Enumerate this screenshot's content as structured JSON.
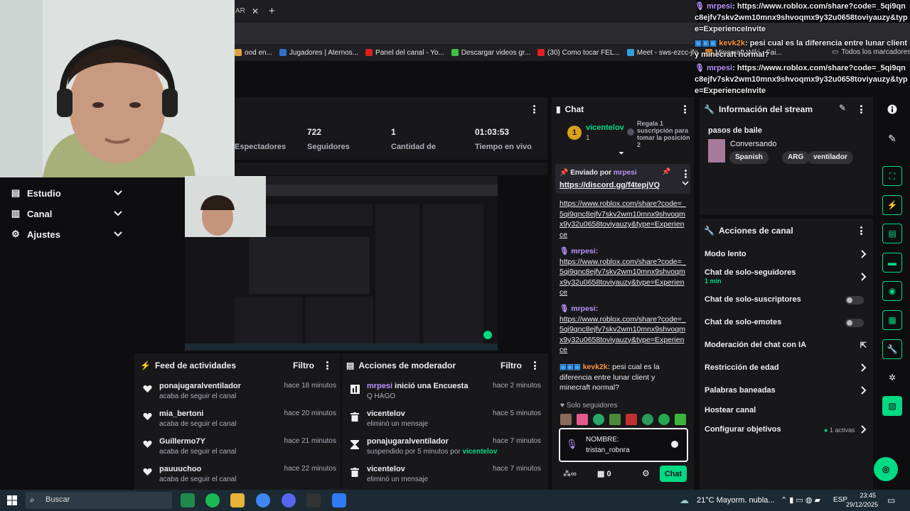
{
  "browser": {
    "tab_fragment": "AR",
    "bookmarks": [
      {
        "label": "ood en...",
        "color": "#e0a040"
      },
      {
        "label": "Jugadores | Aternos...",
        "color": "#3070d0"
      },
      {
        "label": "Panel del canal - Yo...",
        "color": "#e02020"
      },
      {
        "label": "Descargar videos gr...",
        "color": "#40c040"
      },
      {
        "label": "(30) Como tocar FEL...",
        "color": "#e02020"
      },
      {
        "label": "Meet - sws-ezcc-jfq",
        "color": "#30a0e0"
      },
      {
        "label": "Minecraft Wiki - Fai...",
        "color": "#e08020"
      }
    ],
    "all_bookmarks": "Todos los marcadores"
  },
  "nav": {
    "items": [
      {
        "label": "Estudio"
      },
      {
        "label": "Canal"
      },
      {
        "label": "Ajustes"
      }
    ]
  },
  "stats": {
    "items": [
      {
        "value": "",
        "label": "Espectadores"
      },
      {
        "value": "722",
        "label": "Seguidores"
      },
      {
        "value": "1",
        "label": "Cantidad de"
      },
      {
        "value": "01:03:53",
        "label": "Tiempo en vivo"
      }
    ]
  },
  "activity": {
    "title": "Feed de actividades",
    "filter": "Filtro",
    "rows": [
      {
        "name": "ponajugaralventilador",
        "sub": "acaba de seguir el canal",
        "time": "hace 18 minutos"
      },
      {
        "name": "mia_bertoni",
        "sub": "acaba de seguir el canal",
        "time": "hace 20 minutos"
      },
      {
        "name": "Guillermo7Y",
        "sub": "acaba de seguir el canal",
        "time": "hace 21 minutos"
      },
      {
        "name": "pauuuchoo",
        "sub": "acaba de seguir el canal",
        "time": "hace 22 minutos"
      }
    ]
  },
  "moderator": {
    "title": "Acciones de moderador",
    "filter": "Filtro",
    "rows": [
      {
        "name": "mrpesi",
        "action": " inició una Encuesta",
        "sub": "Q HAGO",
        "time": "hace 2 minutos"
      },
      {
        "name": "vicentelov",
        "action": "",
        "sub": "eliminó un mensaje",
        "time": "hace 5 minutos"
      },
      {
        "name": "ponajugaralventilador",
        "action": "",
        "sub": "suspendido por 5 minutos por ",
        "sub_user": "vicentelov",
        "time": "hace 7 minutos"
      },
      {
        "name": "vicentelov",
        "action": "",
        "sub": "eliminó un mensaje",
        "time": "hace 7 minutos"
      }
    ]
  },
  "chat": {
    "title": "Chat",
    "gift": {
      "rank": "1",
      "user": "vicentelov",
      "count": "1",
      "promo": "Regala 1 suscripción para tomar la posición 2"
    },
    "pinned": {
      "label": "Enviado por",
      "user": "mrpesi",
      "link": "https://discord.gg/f4tepjVQ"
    },
    "messages": [
      {
        "user": "",
        "link": "https://www.roblox.com/share?code=_5qi9qnc8ejfv7skv2wm10mnx9shvoqmx9y32u0658toviyauzy&type=Experience"
      },
      {
        "user": "mrpesi",
        "link": "https://www.roblox.com/share?code=_5qi9qnc8ejfv7skv2wm10mnx9shvoqmx9y32u0658toviyauzy&type=Experience"
      },
      {
        "user": "mrpesi",
        "link": "https://www.roblox.com/share?code=_5qi9qnc8ejfv7skv2wm10mnx9shvoqmx9y32u0658toviyauzy&type=Experience"
      }
    ],
    "last": {
      "user": "kevk2k",
      "text": "pesi cual es la diferencia entre lunar client y minecraft normal?"
    },
    "mode": "Solo seguidores",
    "input": {
      "line1": "NOMBRE:",
      "line2": "tristan_robnra"
    },
    "points": "0",
    "send": "Chat"
  },
  "overlay": {
    "msg1_user": "mrpesi",
    "msg1_text": "https://www.roblox.com/share?code=_5qi9qnc8ejfv7skv2wm10mnx9shvoqmx9y32u0658toviyauzy&type=ExperienceInvite",
    "msg2_user": "kevk2k",
    "msg2_text": "pesi cual es la diferencia entre lunar client y minecraft normal?",
    "msg3_user": "mrpesi",
    "msg3_text": "https://www.roblox.com/share?code=_5qi9qnc8ejfv7skv2wm10mnx9shvoqmx9y32u0658toviyauzy&type=ExperienceInvite"
  },
  "info": {
    "title": "Información del stream",
    "stream_title": "pasos de baile",
    "category": "Conversando",
    "tags": [
      "Spanish",
      "ARG",
      "ventilador"
    ]
  },
  "actions": {
    "title": "Acciones de canal",
    "rows": [
      {
        "label": "Modo lento",
        "control": "chevron"
      },
      {
        "label": "Chat de solo-seguidores",
        "sub": "1 min",
        "control": "chevron"
      },
      {
        "label": "Chat de solo-suscriptores",
        "control": "toggle"
      },
      {
        "label": "Chat de solo-emotes",
        "control": "toggle"
      },
      {
        "label": "Moderación del chat con IA",
        "control": "external"
      },
      {
        "label": "Restricción de edad",
        "control": "chevron"
      },
      {
        "label": "Palabras baneadas",
        "control": "chevron"
      },
      {
        "label": "Hostear canal",
        "control": "none"
      },
      {
        "label": "Configurar objetivos",
        "badge": "1 activas",
        "control": "chevron"
      }
    ]
  },
  "taskbar": {
    "search": "Buscar",
    "weather": "21°C  Mayorm. nubla...",
    "lang": "ESP",
    "time": "23:45",
    "date": "29/12/2025"
  },
  "colors": {
    "accent": "#00db84",
    "purple": "#bf94ff",
    "orange": "#ff9742"
  }
}
